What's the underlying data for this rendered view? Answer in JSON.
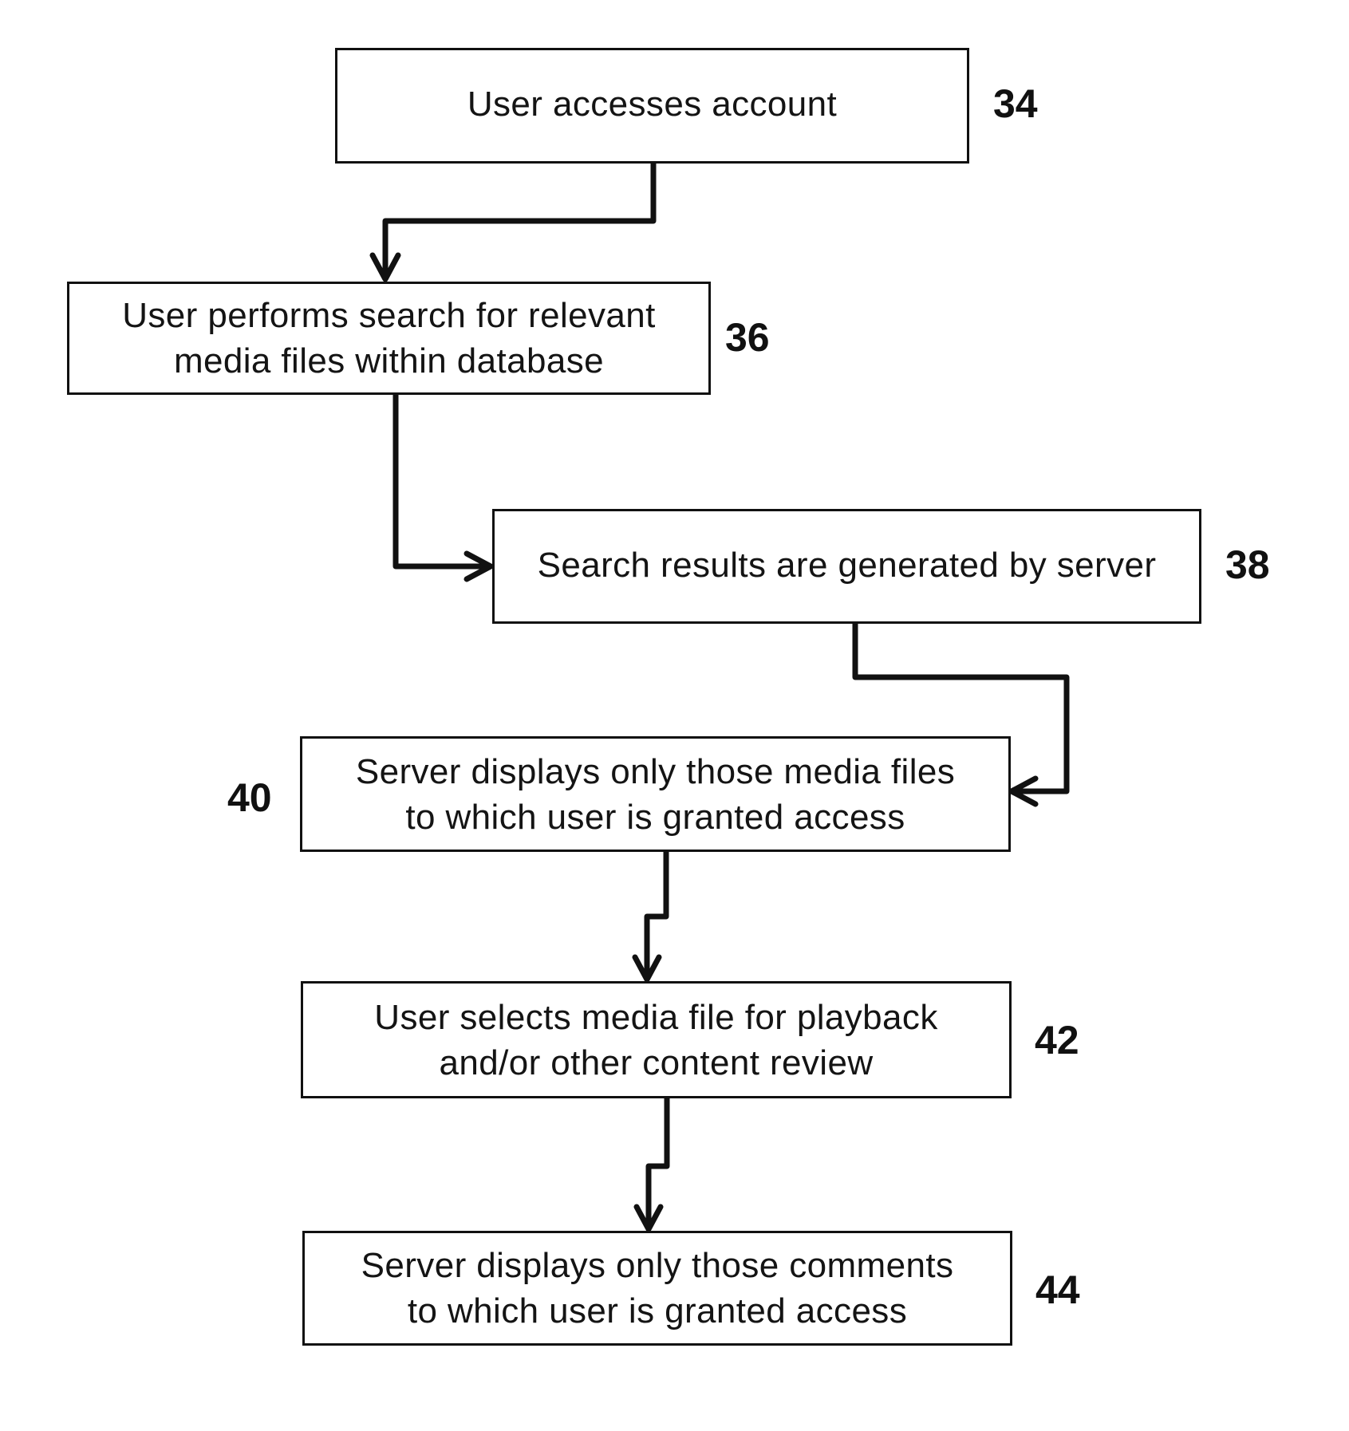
{
  "diagram": {
    "type": "flowchart",
    "line_color": "#111111",
    "background_color": "#ffffff",
    "steps": [
      {
        "id": "34",
        "ref": "34",
        "text": "User accesses account"
      },
      {
        "id": "36",
        "ref": "36",
        "text": "User performs search for relevant\nmedia files within database"
      },
      {
        "id": "38",
        "ref": "38",
        "text": "Search results are generated by server"
      },
      {
        "id": "40",
        "ref": "40",
        "text": "Server displays only those media files\nto which user is granted access"
      },
      {
        "id": "42",
        "ref": "42",
        "text": "User selects media file for playback\nand/or other content review"
      },
      {
        "id": "44",
        "ref": "44",
        "text": "Server displays only those comments\nto which user is granted access"
      }
    ],
    "edges": [
      {
        "from": "34",
        "to": "36"
      },
      {
        "from": "36",
        "to": "38"
      },
      {
        "from": "38",
        "to": "40"
      },
      {
        "from": "40",
        "to": "42"
      },
      {
        "from": "42",
        "to": "44"
      }
    ]
  }
}
